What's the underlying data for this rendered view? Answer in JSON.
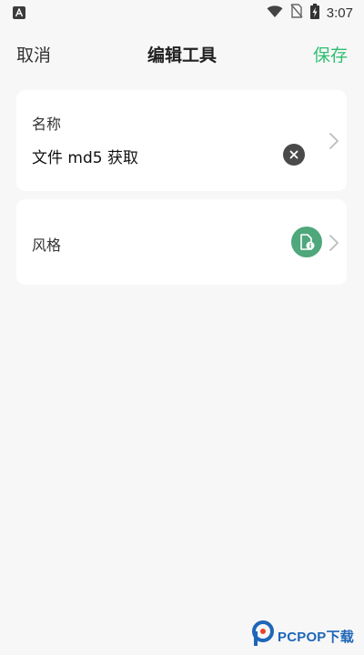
{
  "status_bar": {
    "time": "3:07",
    "icons": [
      "app-notification-icon",
      "wifi-icon",
      "no-sim-icon",
      "battery-charging-icon"
    ]
  },
  "top_bar": {
    "cancel_label": "取消",
    "title": "编辑工具",
    "save_label": "保存",
    "save_color": "#2fbf71"
  },
  "name_card": {
    "label": "名称",
    "value": "文件 md5 获取",
    "clear_icon": "clear-icon",
    "chevron_icon": "chevron-right-icon"
  },
  "style_card": {
    "label": "风格",
    "style_icon": "file-info-icon",
    "style_icon_color": "#4fa77c",
    "chevron_icon": "chevron-right-icon"
  },
  "watermark": {
    "logo_icon": "pcpop-logo-icon",
    "text": "PCPOP下载"
  }
}
